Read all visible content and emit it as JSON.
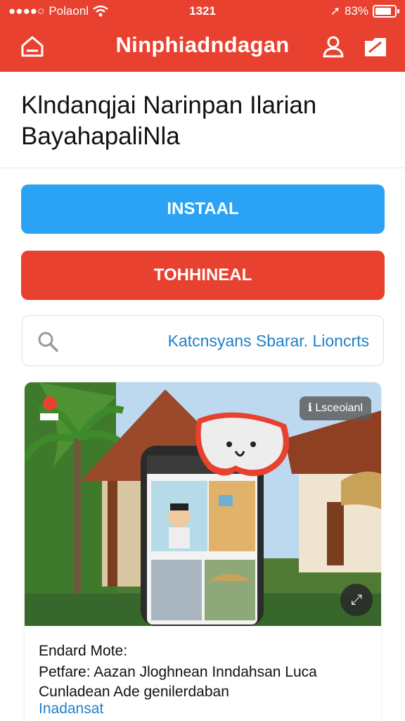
{
  "status_bar": {
    "carrier": "Polaonl",
    "time": "1321",
    "battery": "83%"
  },
  "app_bar": {
    "title": "Ninphiadndagan"
  },
  "headline": {
    "line1": "Klndanqjai Narinpan Ilarian",
    "line2": "BayahapaliNla"
  },
  "buttons": {
    "install": "INSTAAL",
    "secondary": "TOHHINEAL"
  },
  "search": {
    "placeholder": "Katcnsyans Sbarar. Lioncrts"
  },
  "card": {
    "badge": "Lsceoianl",
    "label": "Endard Mote:",
    "desc_line1": "Petfare: Aazan Jloghnean Inndahsan  Luca",
    "desc_line2": "Cunladean  Ade genilerdaban",
    "link": "Inadansat"
  },
  "colors": {
    "brand_red": "#e8412f",
    "install_blue": "#2aa3f4",
    "link_blue": "#1f7fc8"
  },
  "icons": [
    "home-icon",
    "user-icon",
    "share-icon",
    "search-icon",
    "expand-icon"
  ]
}
